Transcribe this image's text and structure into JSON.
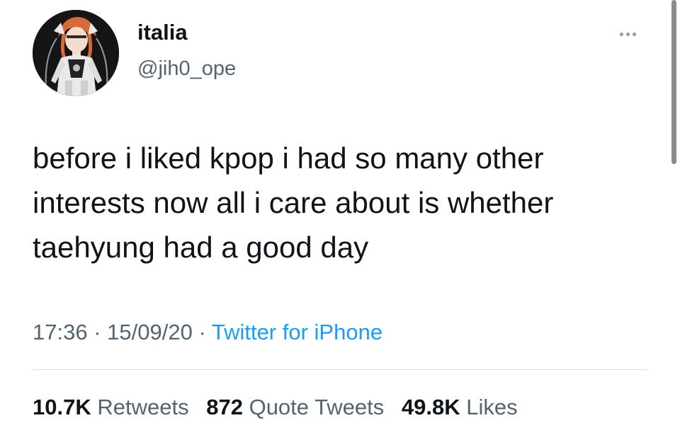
{
  "user": {
    "display_name": "italia",
    "handle": "@jih0_ope",
    "avatar": "anime-character-avatar"
  },
  "tweet": {
    "text": "before i liked kpop i had so many other interests now all i care about is whether taehyung had a good day",
    "time": "17:36",
    "date": "15/09/20",
    "separator": "·",
    "source": "Twitter for iPhone"
  },
  "stats": {
    "retweets_count": "10.7K",
    "retweets_label": "Retweets",
    "quote_count": "872",
    "quote_label": "Quote Tweets",
    "likes_count": "49.8K",
    "likes_label": "Likes"
  },
  "icons": {
    "more": "more-horizontal-icon"
  },
  "colors": {
    "text_primary": "#0f1419",
    "text_secondary": "#536471",
    "link": "#1d9bf0",
    "divider": "#d9dde1"
  }
}
